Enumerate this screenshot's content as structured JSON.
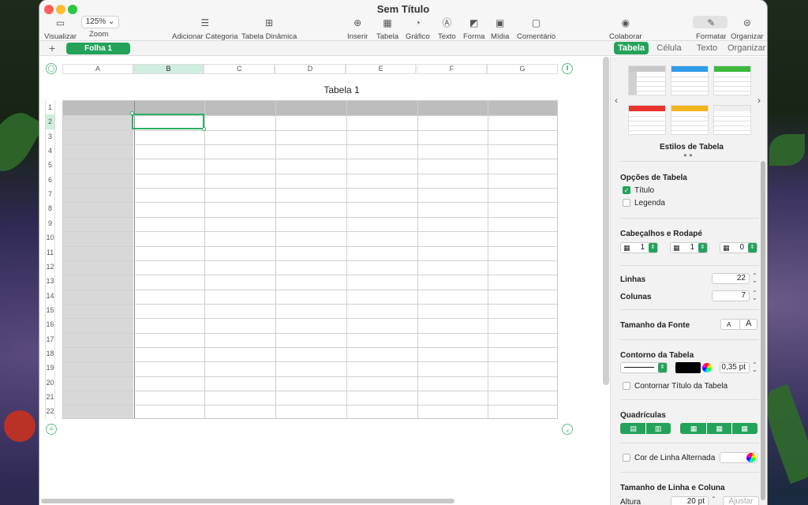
{
  "window": {
    "title": "Sem Título"
  },
  "toolbar": {
    "visualizar": "Visualizar",
    "zoom_value": "125%",
    "zoom": "Zoom",
    "adicionar_categoria": "Adicionar Categoria",
    "tabela_dinamica": "Tabela Dinâmica",
    "inserir": "Inserir",
    "tabela": "Tabela",
    "grafico": "Gráfico",
    "texto": "Texto",
    "forma": "Forma",
    "midia": "Mídia",
    "comentario": "Comentário",
    "colaborar": "Colaborar",
    "formatar": "Formatar",
    "organizar": "Organizar"
  },
  "sheets": {
    "add": "+",
    "active": "Folha 1"
  },
  "inspector_tabs": [
    "Tabela",
    "Célula",
    "Texto",
    "Organizar"
  ],
  "table": {
    "title": "Tabela 1",
    "columns": [
      "A",
      "B",
      "C",
      "D",
      "E",
      "F",
      "G"
    ],
    "rows": [
      "1",
      "2",
      "3",
      "4",
      "5",
      "6",
      "7",
      "8",
      "9",
      "10",
      "11",
      "12",
      "13",
      "14",
      "15",
      "16",
      "17",
      "18",
      "19",
      "20",
      "21",
      "22"
    ],
    "selected_column": "B",
    "selected_row": "2"
  },
  "inspector": {
    "styles_label": "Estilos de Tabela",
    "style_colors": [
      "#c8c8c8",
      "#2e9be8",
      "#3cb83c",
      "#e8342a",
      "#f1b41c",
      "#ffffff"
    ],
    "opcoes_label": "Opções de Tabela",
    "titulo": "Título",
    "titulo_checked": true,
    "legenda": "Legenda",
    "legenda_checked": false,
    "cabecalhos_label": "Cabeçalhos e Rodapé",
    "header_rows": "1",
    "header_cols": "1",
    "footer_rows": "0",
    "linhas_label": "Linhas",
    "linhas_value": "22",
    "colunas_label": "Colunas",
    "colunas_value": "7",
    "fonte_label": "Tamanho da Fonte",
    "font_small": "A",
    "font_large": "A",
    "contorno_label": "Contorno da Tabela",
    "contorno_value": "0,35 pt",
    "contorno_color": "#000000",
    "contornar_titulo": "Contornar Título da Tabela",
    "quadriculas_label": "Quadrículas",
    "cor_linha_alt": "Cor de Linha Alternada",
    "tamanho_label": "Tamanho de Linha e Coluna",
    "altura_label": "Altura",
    "altura_value": "20 pt",
    "ajustar": "Ajustar"
  }
}
